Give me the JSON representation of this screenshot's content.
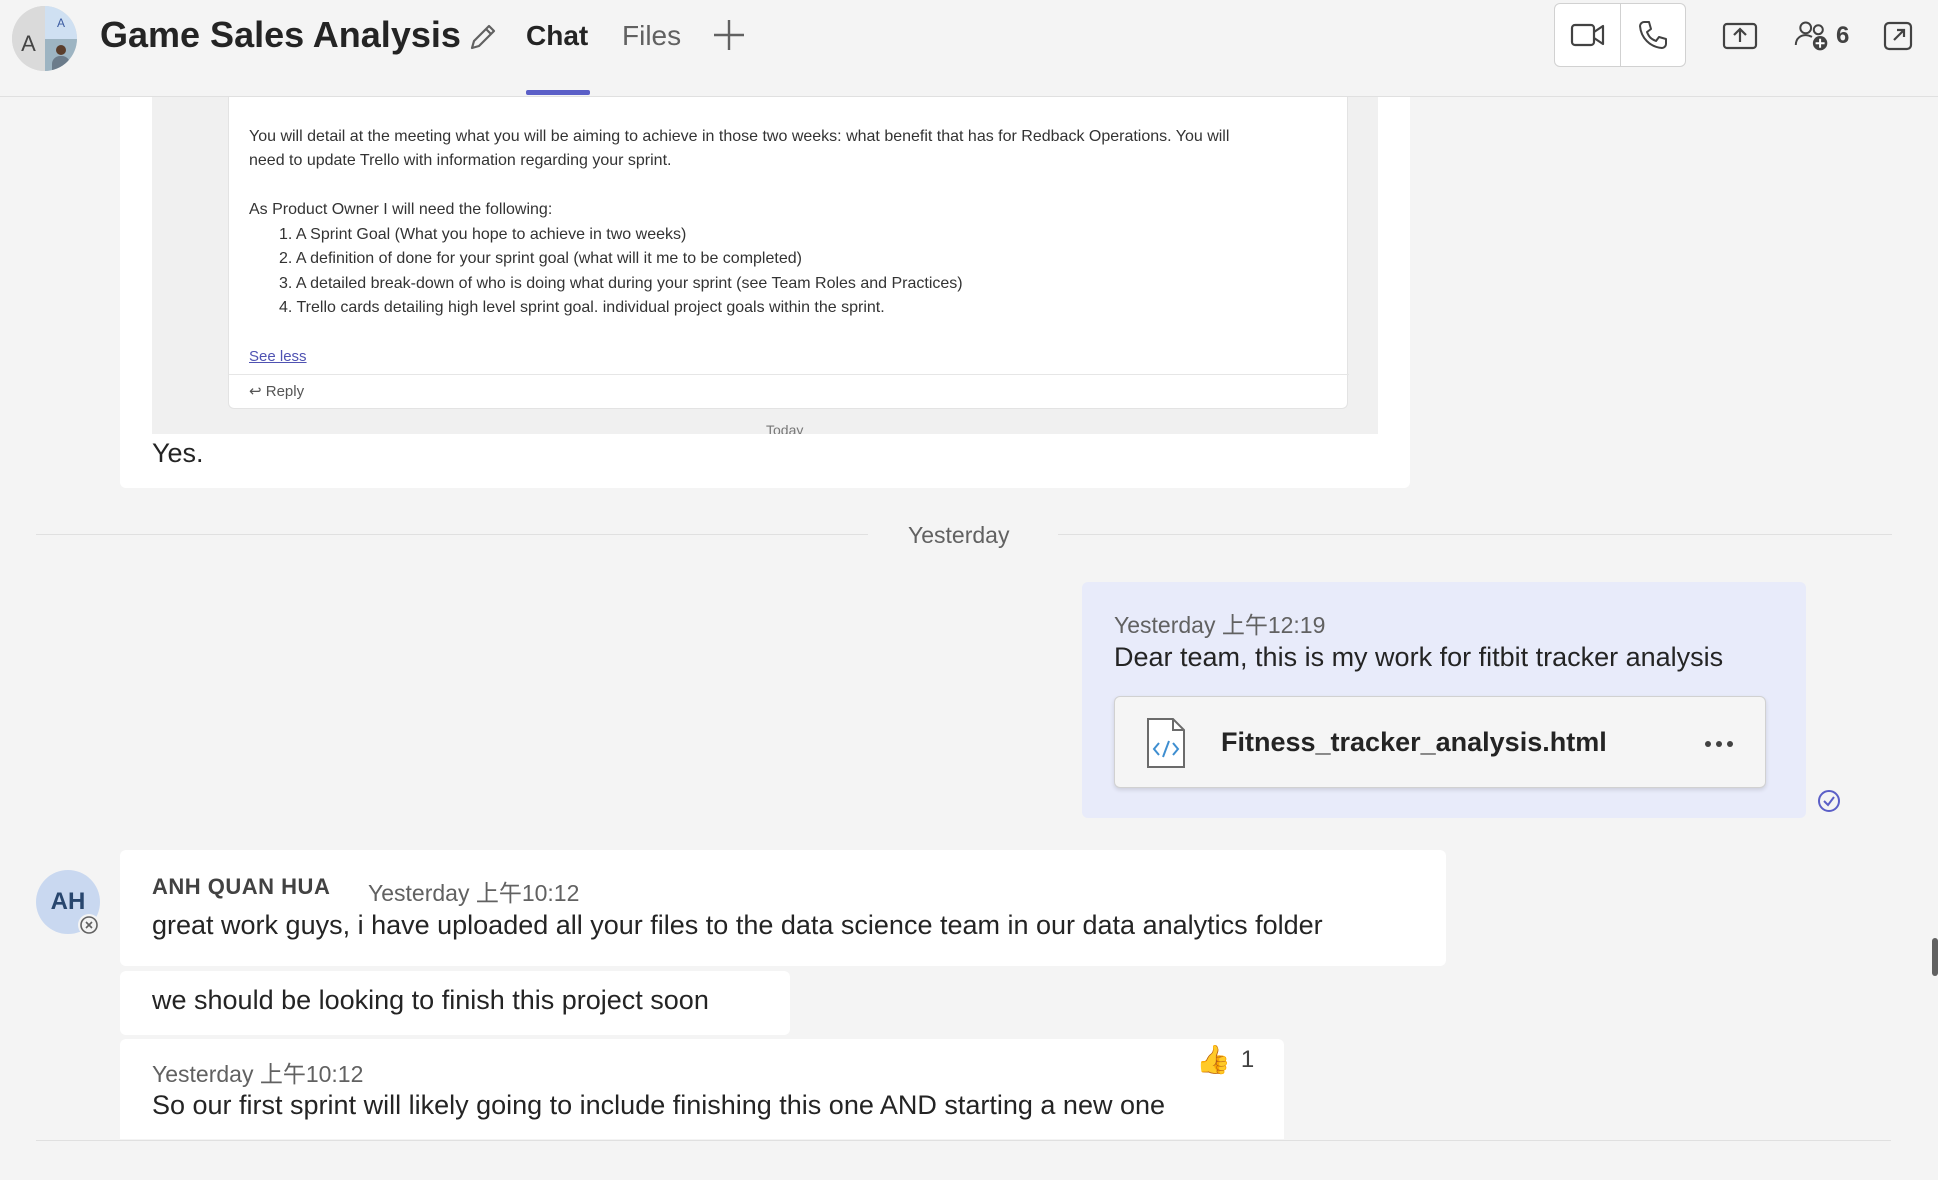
{
  "header": {
    "avatar_letter": "A",
    "avatar_small_letter": "A",
    "title": "Game Sales Analysis",
    "tabs": [
      {
        "label": "Chat",
        "active": true
      },
      {
        "label": "Files",
        "active": false
      }
    ],
    "participants_count": "6",
    "icons": [
      "edit-icon",
      "add-tab-icon",
      "video-call-icon",
      "audio-call-icon",
      "share-screen-icon",
      "add-people-icon",
      "pop-out-icon"
    ]
  },
  "screenshot_message": {
    "lines": [
      "You will detail at the meeting what you will be aiming to achieve in those two weeks: what benefit that has for Redback Operations. You will",
      "need to update Trello with information regarding your sprint.",
      "As Product Owner I will need the following:",
      "1. A Sprint Goal (What you hope to achieve in two weeks)",
      "2. A definition of done for your sprint goal (what will it me to be completed)",
      "3. A detailed break-down of who is doing what during your sprint (see Team Roles and Practices)",
      "4. Trello cards detailing high level sprint goal. individual project goals within the sprint."
    ],
    "see_less": "See less",
    "reply": "Reply",
    "today": "Today",
    "caption": "Yes."
  },
  "date_divider": "Yesterday",
  "my_message": {
    "timestamp": "Yesterday 上午12:19",
    "text": "Dear team, this is my work for fitbit tracker analysis",
    "attachment": {
      "name": "Fitness_tracker_analysis.html",
      "icon": "code-file-icon"
    }
  },
  "thread": {
    "avatar_initials": "AH",
    "sender": "ANH QUAN HUA",
    "timestamp": "Yesterday 上午10:12",
    "messages": [
      "great work guys, i have uploaded all your files to the data science team in our data analytics folder",
      "we should be looking to finish this project soon"
    ],
    "last": {
      "timestamp": "Yesterday 上午10:12",
      "text": "So our first sprint will likely going to include finishing this one AND starting a new one",
      "reaction_emoji": "👍",
      "reaction_count": "1"
    }
  }
}
